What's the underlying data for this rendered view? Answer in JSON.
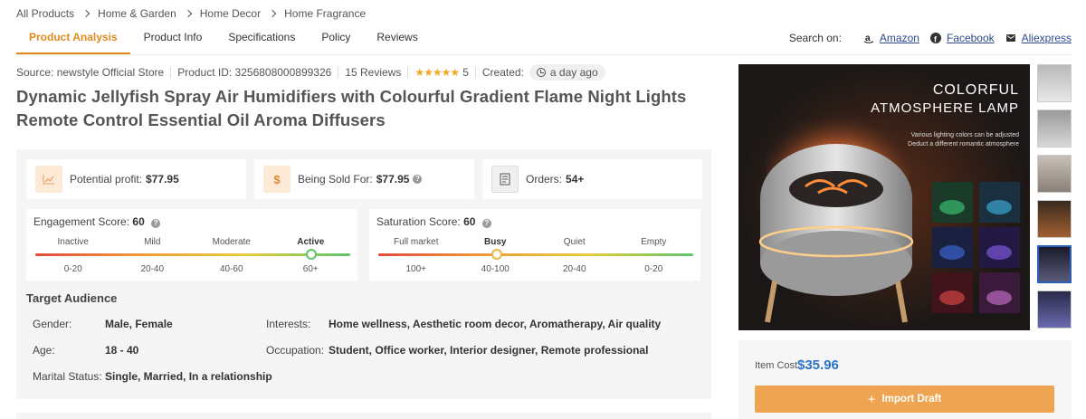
{
  "breadcrumb": [
    "All Products",
    "Home & Garden",
    "Home Decor",
    "Home Fragrance"
  ],
  "tabs": [
    {
      "label": "Product Analysis",
      "active": true
    },
    {
      "label": "Product Info",
      "active": false
    },
    {
      "label": "Specifications",
      "active": false
    },
    {
      "label": "Policy",
      "active": false
    },
    {
      "label": "Reviews",
      "active": false
    }
  ],
  "search_on": {
    "label": "Search on:",
    "links": [
      {
        "label": "Amazon",
        "icon": "amazon-icon"
      },
      {
        "label": "Facebook",
        "icon": "facebook-icon"
      },
      {
        "label": "Aliexpress",
        "icon": "aliexpress-icon"
      }
    ]
  },
  "meta": {
    "source": "Source: newstyle Official Store",
    "product_id": "Product ID: 3256808000899326",
    "reviews": "15 Reviews",
    "rating": "5",
    "rating_stars": 5,
    "created_label": "Created:",
    "created_value": "a day ago"
  },
  "title": "Dynamic Jellyfish Spray Air Humidifiers with Colourful Gradient Flame Night Lights Remote Control Essential Oil Aroma Diffusers",
  "stats": {
    "profit_label": "Potential profit:",
    "profit_value": "$77.95",
    "sold_label": "Being Sold For:",
    "sold_value": "$77.95",
    "orders_label": "Orders:",
    "orders_value": "54+",
    "sold_icon_text": "$"
  },
  "engagement": {
    "label": "Engagement Score:",
    "score": "60",
    "level": 0.875,
    "labels": [
      "Inactive",
      "Mild",
      "Moderate",
      "Active"
    ],
    "ranges": [
      "0-20",
      "20-40",
      "40-60",
      "60+"
    ],
    "active_index": 3
  },
  "saturation": {
    "label": "Saturation Score:",
    "score": "60",
    "level": 0.375,
    "labels": [
      "Full market",
      "Busy",
      "Quiet",
      "Empty"
    ],
    "ranges": [
      "100+",
      "40-100",
      "20-40",
      "0-20"
    ],
    "active_index": 1
  },
  "audience": {
    "title": "Target Audience",
    "gender_label": "Gender:",
    "gender": "Male, Female",
    "age_label": "Age:",
    "age": "18 - 40",
    "marital_label": "Marital Status:",
    "marital": "Single, Married, In a relationship",
    "interests_label": "Interests:",
    "interests": "Home wellness, Aesthetic room decor, Aromatherapy, Air quality",
    "occupation_label": "Occupation:",
    "occupation": "Student, Office worker, Interior designer, Remote professional"
  },
  "image": {
    "headline1": "COLORFUL",
    "headline2": "ATMOSPHERE LAMP",
    "sub1": "Various lighting colors can be adjusted",
    "sub2": "Deduct a different romantic atmosphere"
  },
  "cost": {
    "label": "Item Cost",
    "value": "$35.96",
    "import_label": "Import Draft"
  },
  "colors": {
    "accent": "#e08a1e",
    "button": "#eea450",
    "price": "#2b73c8",
    "link": "#2b4a8c"
  }
}
